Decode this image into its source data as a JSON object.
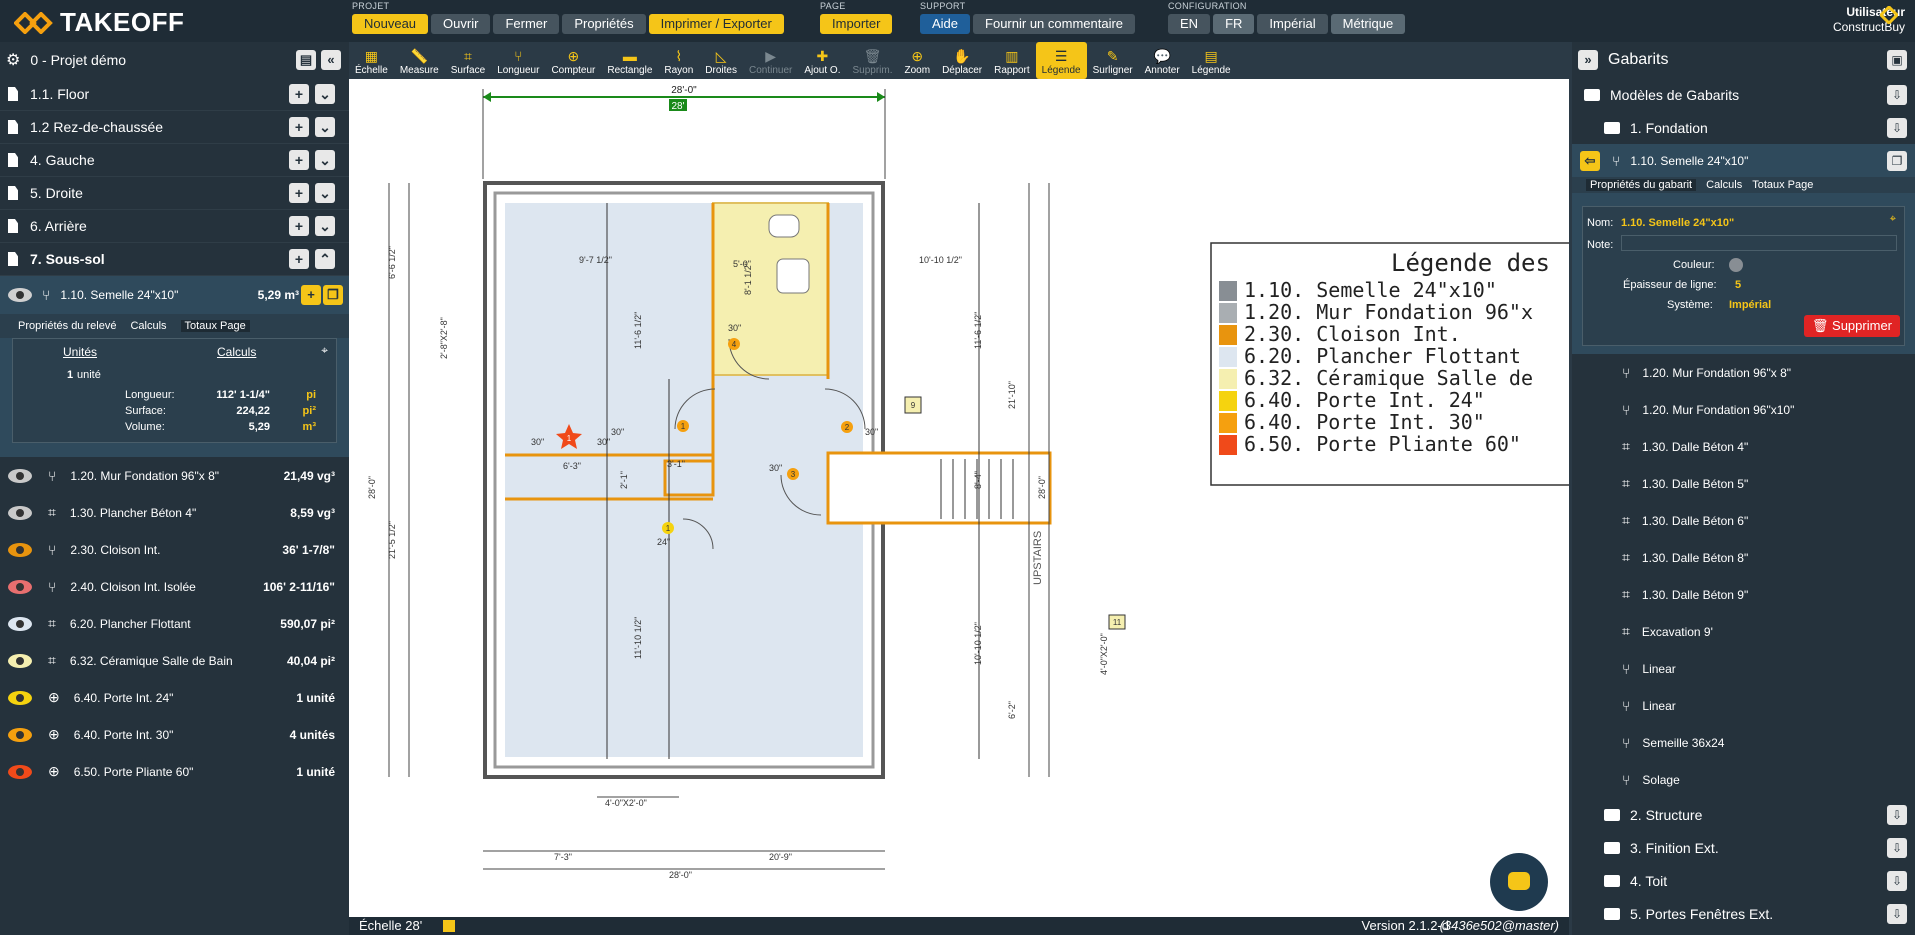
{
  "logo": {
    "text": "TAKEOFF"
  },
  "menus": [
    {
      "label": "PROJET",
      "items": [
        {
          "label": "Nouveau",
          "style": "y"
        },
        {
          "label": "Ouvrir",
          "style": ""
        },
        {
          "label": "Fermer",
          "style": ""
        },
        {
          "label": "Propriétés",
          "style": ""
        },
        {
          "label": "Imprimer / Exporter",
          "style": "y"
        }
      ]
    },
    {
      "label": "PAGE",
      "items": [
        {
          "label": "Importer",
          "style": "y"
        }
      ]
    },
    {
      "label": "SUPPORT",
      "items": [
        {
          "label": "Aide",
          "style": "b"
        },
        {
          "label": "Fournir un commentaire",
          "style": ""
        }
      ]
    },
    {
      "label": "CONFIGURATION",
      "items": [
        {
          "label": "EN",
          "style": ""
        },
        {
          "label": "FR",
          "style": "sel"
        },
        {
          "label": "Impérial",
          "style": ""
        },
        {
          "label": "Métrique",
          "style": "sel"
        }
      ]
    }
  ],
  "user": {
    "title": "Utilisateur",
    "name": "ConstructBuy"
  },
  "project": {
    "name": "0 - Projet démo"
  },
  "pages": [
    "1.1. Floor",
    "1.2 Rez-de-chaussée",
    "4. Gauche",
    "5. Droite",
    "6. Arrière",
    "7. Sous-sol"
  ],
  "selected": {
    "label": "1.10. Semelle 24\"x10\"",
    "value": "5,29 m³",
    "tabs": [
      "Propriétés du relevé",
      "Calculs",
      "Totaux Page"
    ],
    "units_header": "Unités",
    "calc_header": "Calculs",
    "count": "1",
    "count_unit": "unité",
    "rows": [
      {
        "k": "Longueur:",
        "v": "112' 1-1/4\"",
        "u": "pi"
      },
      {
        "k": "Surface:",
        "v": "224,22",
        "u": "pi²"
      },
      {
        "k": "Volume:",
        "v": "5,29",
        "u": "m³"
      }
    ]
  },
  "items": [
    {
      "label": "1.20. Mur Fondation 96\"x 8\"",
      "value": "21,49 vg³",
      "eye": "#c9c9c9",
      "type": "⑂"
    },
    {
      "label": "1.30. Plancher Béton 4\"",
      "value": "8,59 vg³",
      "eye": "#c9c9c9",
      "type": "⌗"
    },
    {
      "label": "2.30. Cloison Int.",
      "value": "36' 1-7/8\"",
      "eye": "#e8940e",
      "type": "⑂"
    },
    {
      "label": "2.40. Cloison Int. Isolée",
      "value": "106' 2-11/16\"",
      "eye": "#e86f6f",
      "type": "⑂"
    },
    {
      "label": "6.20. Plancher Flottant",
      "value": "590,07 pi²",
      "eye": "#dde6f0",
      "type": "⌗"
    },
    {
      "label": "6.32. Céramique Salle de Bain",
      "value": "40,04 pi²",
      "eye": "#f5efb0",
      "type": "⌗"
    },
    {
      "label": "6.40. Porte Int. 24\"",
      "value": "1 unité",
      "eye": "#f5d30f",
      "type": "⊕"
    },
    {
      "label": "6.40. Porte Int. 30\"",
      "value": "4 unités",
      "eye": "#f5a00f",
      "type": "⊕"
    },
    {
      "label": "6.50. Porte Pliante 60\"",
      "value": "1 unité",
      "eye": "#f04a1a",
      "type": "⊕"
    }
  ],
  "tools": [
    {
      "label": "Échelle",
      "g": "▦"
    },
    {
      "label": "Measure",
      "g": "📏"
    },
    {
      "label": "Surface",
      "g": "⌗"
    },
    {
      "label": "Longueur",
      "g": "⑂"
    },
    {
      "label": "Compteur",
      "g": "⊕"
    },
    {
      "label": "Rectangle",
      "g": "▬"
    },
    {
      "label": "Rayon",
      "g": "⌇"
    },
    {
      "label": "Droites",
      "g": "◺"
    },
    {
      "label": "Continuer",
      "g": "▶",
      "state": "dis"
    },
    {
      "label": "Ajout O.",
      "g": "✚"
    },
    {
      "label": "Supprim.",
      "g": "🗑",
      "state": "dis"
    },
    {
      "label": "Zoom",
      "g": "⊕"
    },
    {
      "label": "Déplacer",
      "g": "✋"
    },
    {
      "label": "Rapport",
      "g": "▥"
    },
    {
      "label": "Légende",
      "g": "☰",
      "state": "act"
    },
    {
      "label": "Surligner",
      "g": "✎"
    },
    {
      "label": "Annoter",
      "g": "💬"
    },
    {
      "label": "Légende",
      "g": "▤"
    }
  ],
  "legend": {
    "title": "Légende des",
    "rows": [
      {
        "t": "1.10. Semelle 24\"x10\"",
        "c": "#888e94"
      },
      {
        "t": "1.20. Mur Fondation 96\"x",
        "c": "#a9aeb2"
      },
      {
        "t": "2.30. Cloison Int.",
        "c": "#e8940e"
      },
      {
        "t": "6.20. Plancher Flottant",
        "c": "#dde6f0"
      },
      {
        "t": "6.32. Céramique Salle de",
        "c": "#f5efb0"
      },
      {
        "t": "6.40. Porte Int. 24\"",
        "c": "#f5d30f"
      },
      {
        "t": "6.40. Porte Int. 30\"",
        "c": "#f5a00f"
      },
      {
        "t": "6.50. Porte Pliante 60\"",
        "c": "#f04a1a"
      }
    ]
  },
  "plan": {
    "dim_top": "28'-0\"",
    "dim_badge": "28'",
    "dim_bottom": "28'-0\"",
    "d_7_3": "7'-3\"",
    "d_20_9": "20'-9\"",
    "d_4x2": "4'-0\"X2'-0\"",
    "d_4x2v": "4'-0\"X2'-0\"",
    "d_2x8": "2'-8\"X2'-8\"",
    "d_6_6": "6'-6 1/2\"",
    "d_21_5": "21'-5 1/2\"",
    "d_28l": "28'-0\"",
    "d_28r": "28'-0\"",
    "d_21_10": "21'-10\"",
    "d_6_2": "6'-2\"",
    "d_9_7": "9'-7 1/2\"",
    "d_10_10": "10'-10 1/2\"",
    "d_5_0": "5'-0\"",
    "d_8_1": "8'-1 1/2\"",
    "d_11_6a": "11'-6 1/2\"",
    "d_11_6b": "11'-6 1/2\"",
    "d_11_10": "11'-10 1/2\"",
    "d_10_10v": "10'-10 1/2\"",
    "d_6_3": "6'-3\"",
    "d_3_1": "3'-1\"",
    "d_2_1": "2'-1\"",
    "d_8_4": "8'-4\"",
    "upstairs": "UPSTAIRS",
    "d30a": "30\"",
    "d30b": "30\"",
    "d30c": "30\"",
    "d30d": "30\"",
    "d30e": "30\"",
    "d30f": "30\"",
    "d24": "24\"",
    "m1": "1",
    "m2": "2",
    "m3": "3",
    "m4": "4",
    "m5": "1",
    "m6": "1",
    "n9": "9",
    "n11": "11"
  },
  "right": {
    "title": "Gabarits",
    "models": "Modèles de Gabarits",
    "fondation": "1. Fondation",
    "selected": "1.10. Semelle 24\"x10\"",
    "tabs": [
      "Propriétés du gabarit",
      "Calculs",
      "Totaux Page"
    ],
    "nom_label": "Nom:",
    "nom_value": "1.10. Semelle 24\"x10\"",
    "note_label": "Note:",
    "couleur": "Couleur:",
    "epaisseur": "Épaisseur de ligne:",
    "epaisseur_v": "5",
    "systeme": "Système:",
    "systeme_v": "Impérial",
    "delete": "Supprimer",
    "subs": [
      {
        "l": "1.20. Mur Fondation 96\"x 8\"",
        "g": "⑂"
      },
      {
        "l": "1.20. Mur Fondation 96\"x10\"",
        "g": "⑂"
      },
      {
        "l": "1.30. Dalle Béton 4\"",
        "g": "⌗"
      },
      {
        "l": "1.30. Dalle Béton 5\"",
        "g": "⌗"
      },
      {
        "l": "1.30. Dalle Béton 6\"",
        "g": "⌗"
      },
      {
        "l": "1.30. Dalle Béton 8\"",
        "g": "⌗"
      },
      {
        "l": "1.30. Dalle Béton 9\"",
        "g": "⌗"
      },
      {
        "l": "Excavation 9'",
        "g": "⌗"
      },
      {
        "l": "Linear",
        "g": "⑂"
      },
      {
        "l": "Linear",
        "g": "⑂"
      },
      {
        "l": "Semeille 36x24",
        "g": "⑂"
      },
      {
        "l": "Solage",
        "g": "⑂"
      }
    ],
    "folders": [
      "2. Structure",
      "3. Finition Ext.",
      "4. Toit",
      "5. Portes Fenêtres Ext."
    ]
  },
  "status": {
    "scale": "Échelle 28'",
    "version": "Version 2.1.2-d",
    "build": "(3436e502@master)"
  }
}
